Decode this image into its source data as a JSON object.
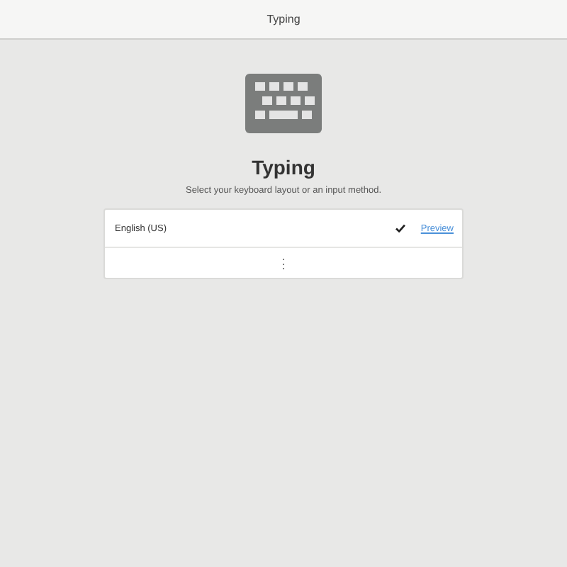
{
  "window": {
    "title": "Typing"
  },
  "heading": "Typing",
  "subtitle": "Select your keyboard layout or an input method.",
  "layouts": [
    {
      "name": "English (US)",
      "selected": true,
      "preview_link": "Preview"
    }
  ],
  "more_button": "⋮"
}
